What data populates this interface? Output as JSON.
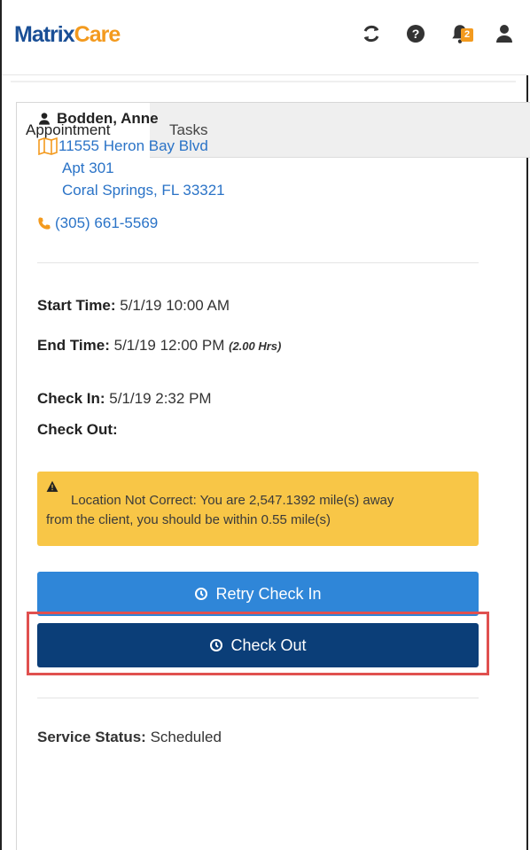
{
  "app": {
    "brand_part1": "Matrix",
    "brand_part2": "Care"
  },
  "header_icons": [
    {
      "name": "refresh-icon"
    },
    {
      "name": "help-icon"
    },
    {
      "name": "notifications-icon",
      "badge": "2"
    },
    {
      "name": "user-icon"
    }
  ],
  "tabs": {
    "appointment": "Appointment",
    "tasks": "Tasks"
  },
  "client": {
    "name": "Bodden, Anne",
    "address_line1": "11555 Heron Bay Blvd",
    "address_line2": "Apt 301",
    "address_line3": "Coral Springs, FL 33321",
    "phone": "(305) 661-5569"
  },
  "times": {
    "start_label": "Start Time:",
    "start_value": "5/1/19 10:00 AM",
    "end_label": "End Time:",
    "end_value": "5/1/19 12:00 PM",
    "duration": "(2.00 Hrs)",
    "checkin_label": "Check In:",
    "checkin_value": "5/1/19 2:32 PM",
    "checkout_label": "Check Out:",
    "checkout_value": ""
  },
  "alert": {
    "line1": "Location Not Correct: You are 2,547.1392 mile(s) away",
    "line2": "from the client, you should be within 0.55 mile(s)"
  },
  "buttons": {
    "retry": "Retry Check In",
    "checkout": "Check Out"
  },
  "service": {
    "label": "Service Status:",
    "value": "Scheduled"
  },
  "colors": {
    "brand_blue": "#1a4f96",
    "brand_orange": "#f39a1e",
    "link_blue": "#2a73c7",
    "alert_bg": "#f8c647",
    "retry_bg": "#2f86d8",
    "checkout_bg": "#0b3e78",
    "highlight": "#e0504f"
  }
}
